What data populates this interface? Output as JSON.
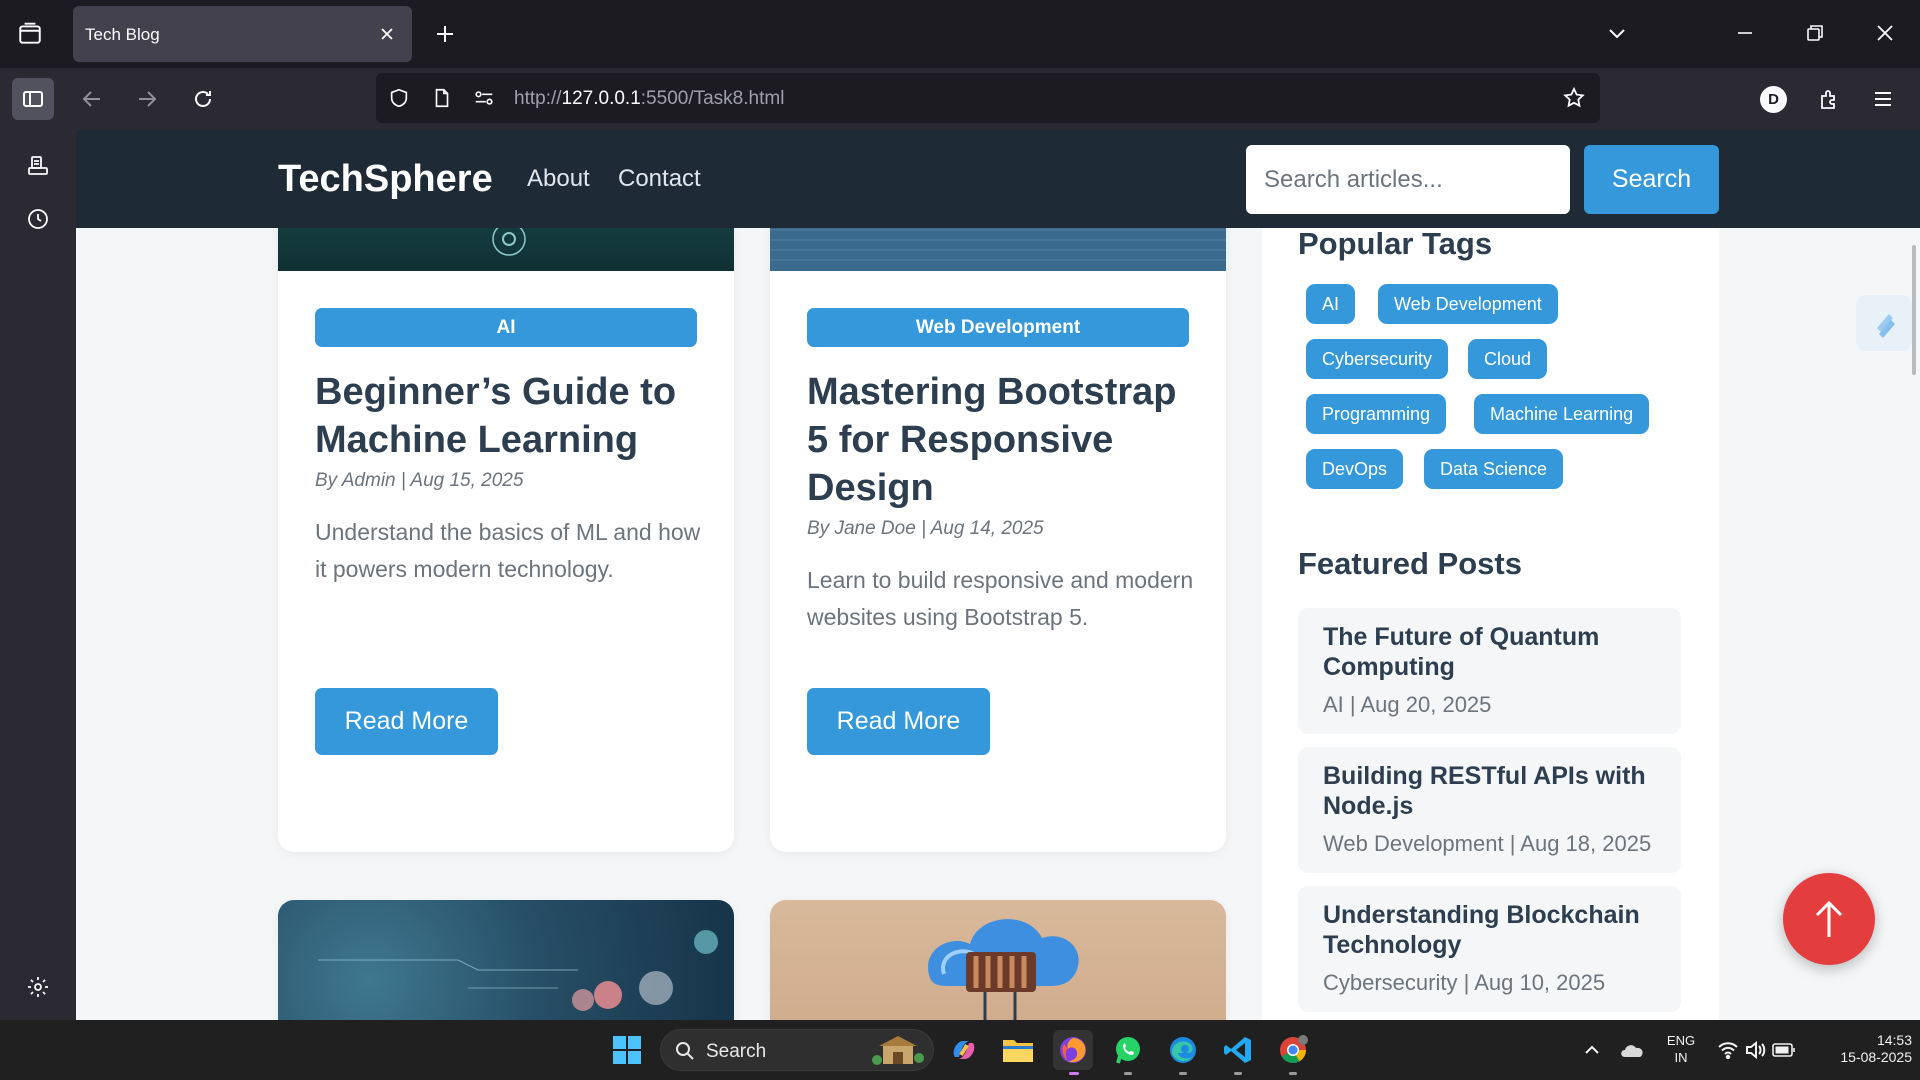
{
  "browser": {
    "tab_title": "Tech Blog",
    "url_prefix": "http://",
    "url_host": "127.0.0.1",
    "url_path": ":5500/Task8.html",
    "profile_initial": "D"
  },
  "site": {
    "brand": "TechSphere",
    "nav": [
      "About",
      "Contact"
    ],
    "search_placeholder": "Search articles...",
    "search_button": "Search",
    "accent_color": "#3498db",
    "header_color": "#1e2a36"
  },
  "posts": [
    {
      "category": "AI",
      "title": "Beginner’s Guide to Machine Learning",
      "meta": "By Admin | Aug 15, 2025",
      "description": "Understand the basics of ML and how it powers modern technology.",
      "button": "Read More"
    },
    {
      "category": "Web Development",
      "title": "Mastering Bootstrap 5 for Responsive Design",
      "meta": "By Jane Doe | Aug 14, 2025",
      "description": "Learn to build responsive and modern websites using Bootstrap 5.",
      "button": "Read More"
    }
  ],
  "sidebar": {
    "tags_heading": "Popular Tags",
    "tags": [
      "AI",
      "Web Development",
      "Cybersecurity",
      "Cloud",
      "Programming",
      "Machine Learning",
      "DevOps",
      "Data Science"
    ],
    "featured_heading": "Featured Posts",
    "featured": [
      {
        "title": "The Future of Quantum Computing",
        "meta": "AI | Aug 20, 2025"
      },
      {
        "title": "Building RESTful APIs with Node.js",
        "meta": "Web Development | Aug 18, 2025"
      },
      {
        "title": "Understanding Blockchain Technology",
        "meta": "Cybersecurity | Aug 10, 2025"
      }
    ]
  },
  "taskbar": {
    "search_label": "Search",
    "language": "ENG",
    "region": "IN",
    "time": "14:53",
    "date": "15-08-2025"
  }
}
